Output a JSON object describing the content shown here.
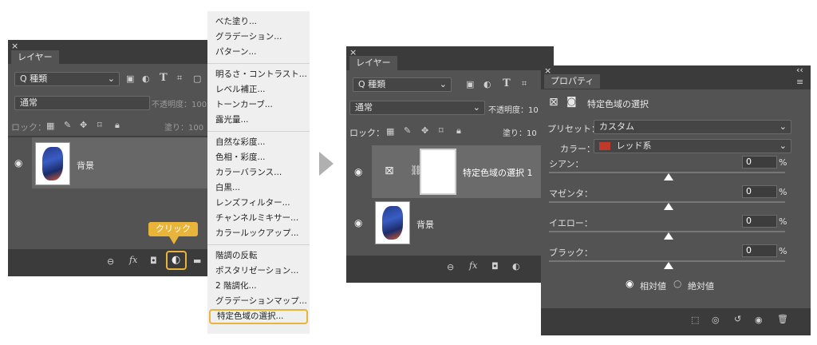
{
  "left_panel": {
    "close": "×",
    "tab": "レイヤー",
    "filter_label": "Q 種類",
    "blend": "通常",
    "opacity_label": "不透明度：100",
    "lock_label": "ロック：",
    "fill_label": "塗り：100",
    "layer_name": "背景",
    "callout": "クリック",
    "fx": "fx"
  },
  "menu": {
    "items": [
      "べた塗り...",
      "グラデーション...",
      "パターン...",
      "明るさ・コントラスト...",
      "レベル補正...",
      "トーンカーブ...",
      "露光量...",
      "自然な彩度...",
      "色相・彩度...",
      "カラーバランス...",
      "白黒...",
      "レンズフィルター...",
      "チャンネルミキサー...",
      "カラールックアップ...",
      "階調の反転",
      "ポスタリゼーション...",
      "2 階調化...",
      "グラデーションマップ...",
      "特定色域の選択..."
    ]
  },
  "mid_panel": {
    "close": "×",
    "collapse": "‹‹",
    "tab": "レイヤー",
    "filter_label": "Q 種類",
    "blend": "通常",
    "opacity_label": "不透明度：10",
    "lock_label": "ロック：",
    "fill_label": "塗り：10",
    "adj_layer_name": "特定色域の選択 1",
    "bg_layer_name": "背景",
    "fx": "fx"
  },
  "properties": {
    "close": "×",
    "collapse": "‹‹",
    "tab": "プロパティ",
    "header": "特定色域の選択",
    "preset_label": "プリセット：",
    "preset_value": "カスタム",
    "color_label": "カラー：",
    "color_value": "レッド系",
    "color_swatch": "#c0392b",
    "sliders": [
      {
        "label": "シアン：",
        "value": "0",
        "unit": "%"
      },
      {
        "label": "マゼンタ：",
        "value": "0",
        "unit": "%"
      },
      {
        "label": "イエロー：",
        "value": "0",
        "unit": "%"
      },
      {
        "label": "ブラック：",
        "value": "0",
        "unit": "%"
      }
    ],
    "relative_label": "相対値",
    "absolute_label": "絶対値"
  },
  "colors": {
    "panel": "#535353",
    "highlight": "#e8b43a",
    "arrow": "#b0b0b0"
  }
}
